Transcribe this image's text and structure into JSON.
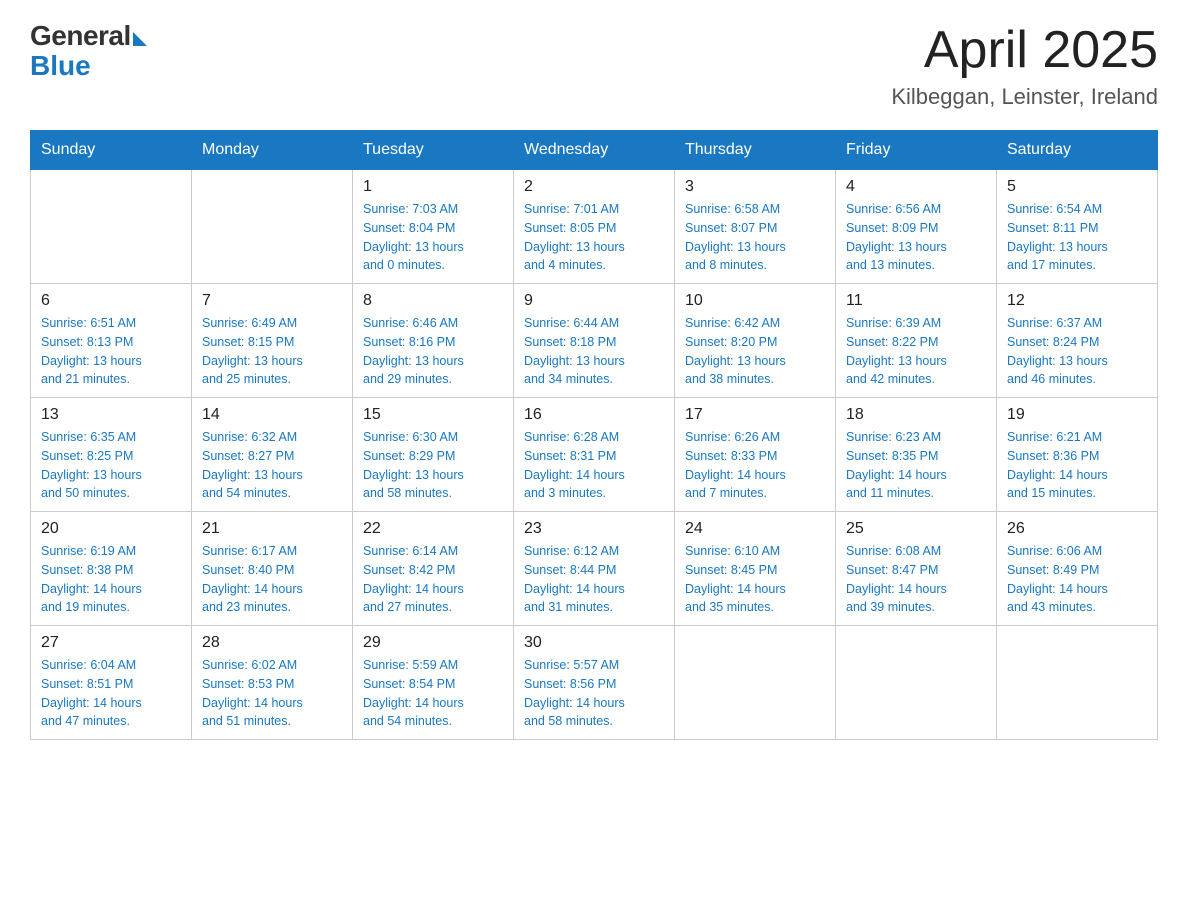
{
  "header": {
    "logo_general": "General",
    "logo_blue": "Blue",
    "month_title": "April 2025",
    "location": "Kilbeggan, Leinster, Ireland"
  },
  "weekdays": [
    "Sunday",
    "Monday",
    "Tuesday",
    "Wednesday",
    "Thursday",
    "Friday",
    "Saturday"
  ],
  "weeks": [
    [
      {
        "day": "",
        "detail": ""
      },
      {
        "day": "",
        "detail": ""
      },
      {
        "day": "1",
        "detail": "Sunrise: 7:03 AM\nSunset: 8:04 PM\nDaylight: 13 hours\nand 0 minutes."
      },
      {
        "day": "2",
        "detail": "Sunrise: 7:01 AM\nSunset: 8:05 PM\nDaylight: 13 hours\nand 4 minutes."
      },
      {
        "day": "3",
        "detail": "Sunrise: 6:58 AM\nSunset: 8:07 PM\nDaylight: 13 hours\nand 8 minutes."
      },
      {
        "day": "4",
        "detail": "Sunrise: 6:56 AM\nSunset: 8:09 PM\nDaylight: 13 hours\nand 13 minutes."
      },
      {
        "day": "5",
        "detail": "Sunrise: 6:54 AM\nSunset: 8:11 PM\nDaylight: 13 hours\nand 17 minutes."
      }
    ],
    [
      {
        "day": "6",
        "detail": "Sunrise: 6:51 AM\nSunset: 8:13 PM\nDaylight: 13 hours\nand 21 minutes."
      },
      {
        "day": "7",
        "detail": "Sunrise: 6:49 AM\nSunset: 8:15 PM\nDaylight: 13 hours\nand 25 minutes."
      },
      {
        "day": "8",
        "detail": "Sunrise: 6:46 AM\nSunset: 8:16 PM\nDaylight: 13 hours\nand 29 minutes."
      },
      {
        "day": "9",
        "detail": "Sunrise: 6:44 AM\nSunset: 8:18 PM\nDaylight: 13 hours\nand 34 minutes."
      },
      {
        "day": "10",
        "detail": "Sunrise: 6:42 AM\nSunset: 8:20 PM\nDaylight: 13 hours\nand 38 minutes."
      },
      {
        "day": "11",
        "detail": "Sunrise: 6:39 AM\nSunset: 8:22 PM\nDaylight: 13 hours\nand 42 minutes."
      },
      {
        "day": "12",
        "detail": "Sunrise: 6:37 AM\nSunset: 8:24 PM\nDaylight: 13 hours\nand 46 minutes."
      }
    ],
    [
      {
        "day": "13",
        "detail": "Sunrise: 6:35 AM\nSunset: 8:25 PM\nDaylight: 13 hours\nand 50 minutes."
      },
      {
        "day": "14",
        "detail": "Sunrise: 6:32 AM\nSunset: 8:27 PM\nDaylight: 13 hours\nand 54 minutes."
      },
      {
        "day": "15",
        "detail": "Sunrise: 6:30 AM\nSunset: 8:29 PM\nDaylight: 13 hours\nand 58 minutes."
      },
      {
        "day": "16",
        "detail": "Sunrise: 6:28 AM\nSunset: 8:31 PM\nDaylight: 14 hours\nand 3 minutes."
      },
      {
        "day": "17",
        "detail": "Sunrise: 6:26 AM\nSunset: 8:33 PM\nDaylight: 14 hours\nand 7 minutes."
      },
      {
        "day": "18",
        "detail": "Sunrise: 6:23 AM\nSunset: 8:35 PM\nDaylight: 14 hours\nand 11 minutes."
      },
      {
        "day": "19",
        "detail": "Sunrise: 6:21 AM\nSunset: 8:36 PM\nDaylight: 14 hours\nand 15 minutes."
      }
    ],
    [
      {
        "day": "20",
        "detail": "Sunrise: 6:19 AM\nSunset: 8:38 PM\nDaylight: 14 hours\nand 19 minutes."
      },
      {
        "day": "21",
        "detail": "Sunrise: 6:17 AM\nSunset: 8:40 PM\nDaylight: 14 hours\nand 23 minutes."
      },
      {
        "day": "22",
        "detail": "Sunrise: 6:14 AM\nSunset: 8:42 PM\nDaylight: 14 hours\nand 27 minutes."
      },
      {
        "day": "23",
        "detail": "Sunrise: 6:12 AM\nSunset: 8:44 PM\nDaylight: 14 hours\nand 31 minutes."
      },
      {
        "day": "24",
        "detail": "Sunrise: 6:10 AM\nSunset: 8:45 PM\nDaylight: 14 hours\nand 35 minutes."
      },
      {
        "day": "25",
        "detail": "Sunrise: 6:08 AM\nSunset: 8:47 PM\nDaylight: 14 hours\nand 39 minutes."
      },
      {
        "day": "26",
        "detail": "Sunrise: 6:06 AM\nSunset: 8:49 PM\nDaylight: 14 hours\nand 43 minutes."
      }
    ],
    [
      {
        "day": "27",
        "detail": "Sunrise: 6:04 AM\nSunset: 8:51 PM\nDaylight: 14 hours\nand 47 minutes."
      },
      {
        "day": "28",
        "detail": "Sunrise: 6:02 AM\nSunset: 8:53 PM\nDaylight: 14 hours\nand 51 minutes."
      },
      {
        "day": "29",
        "detail": "Sunrise: 5:59 AM\nSunset: 8:54 PM\nDaylight: 14 hours\nand 54 minutes."
      },
      {
        "day": "30",
        "detail": "Sunrise: 5:57 AM\nSunset: 8:56 PM\nDaylight: 14 hours\nand 58 minutes."
      },
      {
        "day": "",
        "detail": ""
      },
      {
        "day": "",
        "detail": ""
      },
      {
        "day": "",
        "detail": ""
      }
    ]
  ]
}
